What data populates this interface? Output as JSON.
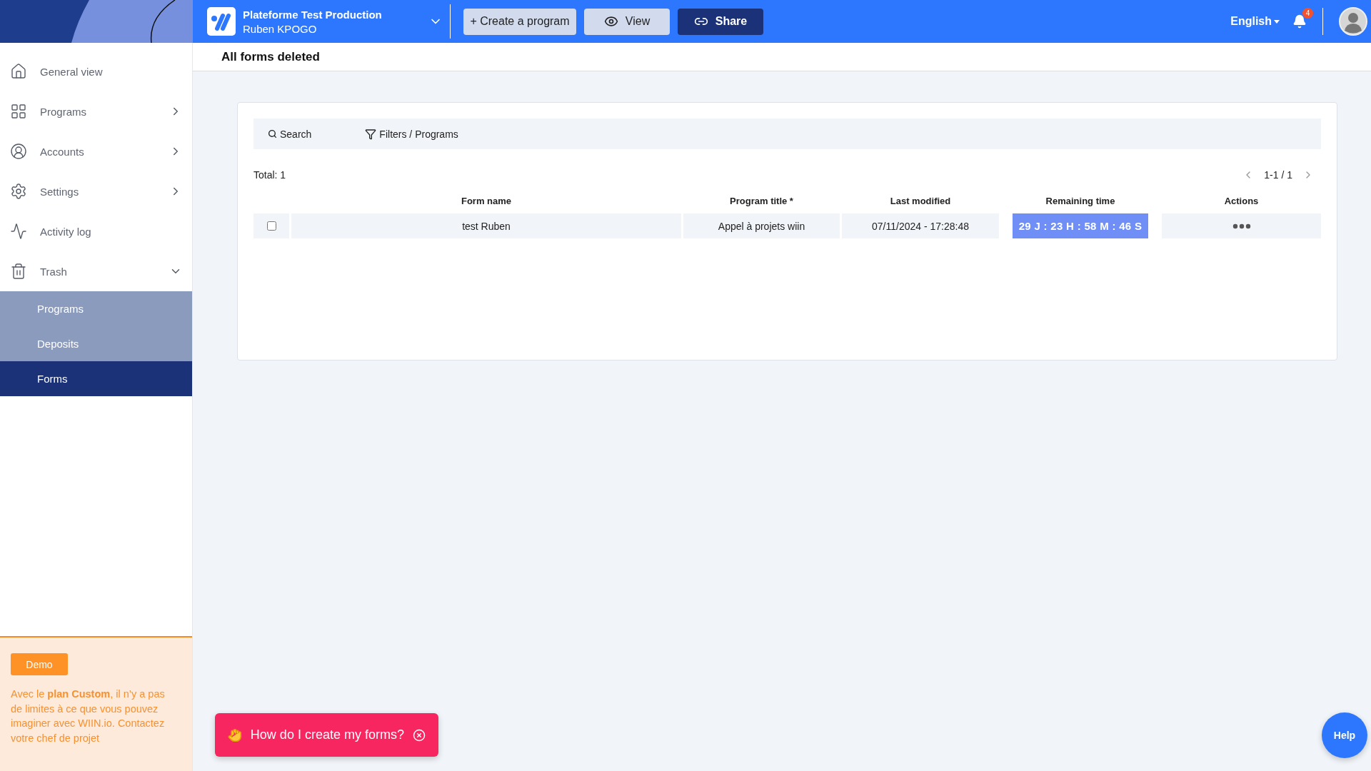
{
  "workspace": {
    "name": "Plateforme Test Production",
    "user": "Ruben KPOGO"
  },
  "top_actions": [
    {
      "label": "+ Create a program",
      "kind": "create"
    },
    {
      "label": "View",
      "kind": "view"
    },
    {
      "label": "Share",
      "kind": "share"
    }
  ],
  "language": "English",
  "notifications": {
    "count": "4"
  },
  "sidebar": {
    "items": [
      {
        "label": "General view"
      },
      {
        "label": "Programs",
        "expanded": false
      },
      {
        "label": "Accounts",
        "expanded": false
      },
      {
        "label": "Settings",
        "expanded": false
      },
      {
        "label": "Activity log"
      },
      {
        "label": "Trash",
        "expanded": true,
        "children": [
          {
            "label": "Programs",
            "selected": false
          },
          {
            "label": "Deposits",
            "selected": false
          },
          {
            "label": "Forms",
            "selected": true
          }
        ]
      }
    ]
  },
  "promo": {
    "badge": "Demo",
    "text": "Avec le **plan Custom**, il n’y a pas de limites à ce que vous pouvez imaginer avec WIIN.io. Contactez votre chef de projet"
  },
  "page_title": "All forms deleted",
  "toolbar": {
    "search": "Search",
    "filters": "Filters / Programs"
  },
  "total": "Total: 1",
  "pagination": "1-1 / 1",
  "table": {
    "columns": [
      "Form name",
      "Program title *",
      "Last modified",
      "Remaining time",
      "Actions"
    ],
    "rows": [
      {
        "checked": false,
        "form_name": "test Ruben",
        "program_title": "Appel à projets wiin",
        "last_modified": "07/11/2024 - 17:28:48",
        "remaining": "29 J : 23 H : 58 M : 46 S"
      }
    ]
  },
  "toast": {
    "text": "How do I create my forms?"
  },
  "help": "Help"
}
